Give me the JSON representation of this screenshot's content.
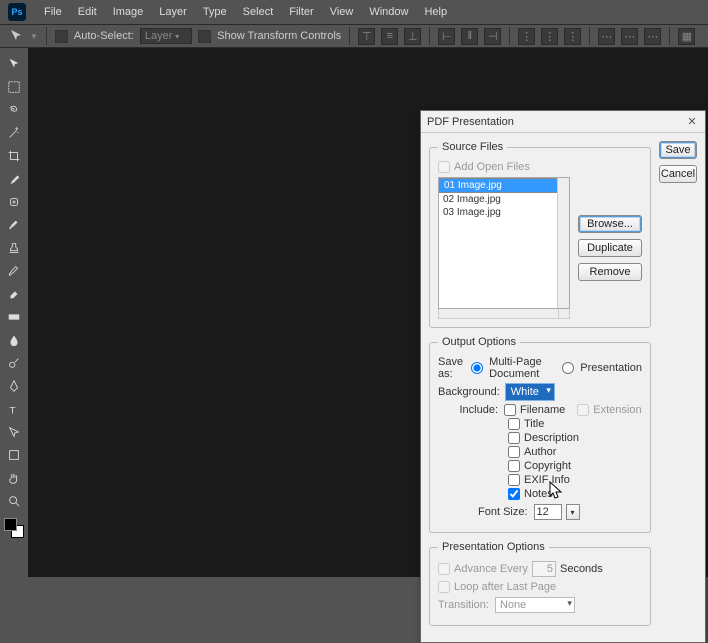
{
  "menubar": {
    "items": [
      "File",
      "Edit",
      "Image",
      "Layer",
      "Type",
      "Select",
      "Filter",
      "View",
      "Window",
      "Help"
    ]
  },
  "options": {
    "auto_select": "Auto-Select:",
    "layer": "Layer",
    "show_transform": "Show Transform Controls"
  },
  "dialog": {
    "title": "PDF Presentation",
    "save": "Save",
    "cancel": "Cancel",
    "source": {
      "legend": "Source Files",
      "add_open": "Add Open Files",
      "files": [
        "01 Image.jpg",
        "02 Image.jpg",
        "03 Image.jpg"
      ],
      "browse": "Browse...",
      "duplicate": "Duplicate",
      "remove": "Remove"
    },
    "output": {
      "legend": "Output Options",
      "saveas_label": "Save as:",
      "multi": "Multi-Page Document",
      "present_radio": "Presentation",
      "bg_label": "Background:",
      "bg_value": "White",
      "include_label": "Include:",
      "filename": "Filename",
      "extension": "Extension",
      "title": "Title",
      "description": "Description",
      "author": "Author",
      "copyright": "Copyright",
      "exif": "EXIF Info",
      "notes": "Notes",
      "fontsize_label": "Font Size:",
      "fontsize": "12"
    },
    "present": {
      "legend": "Presentation Options",
      "advance": "Advance Every",
      "seconds": "Seconds",
      "adv_value": "5",
      "loop": "Loop after Last Page",
      "transition_label": "Transition:",
      "transition": "None"
    }
  }
}
